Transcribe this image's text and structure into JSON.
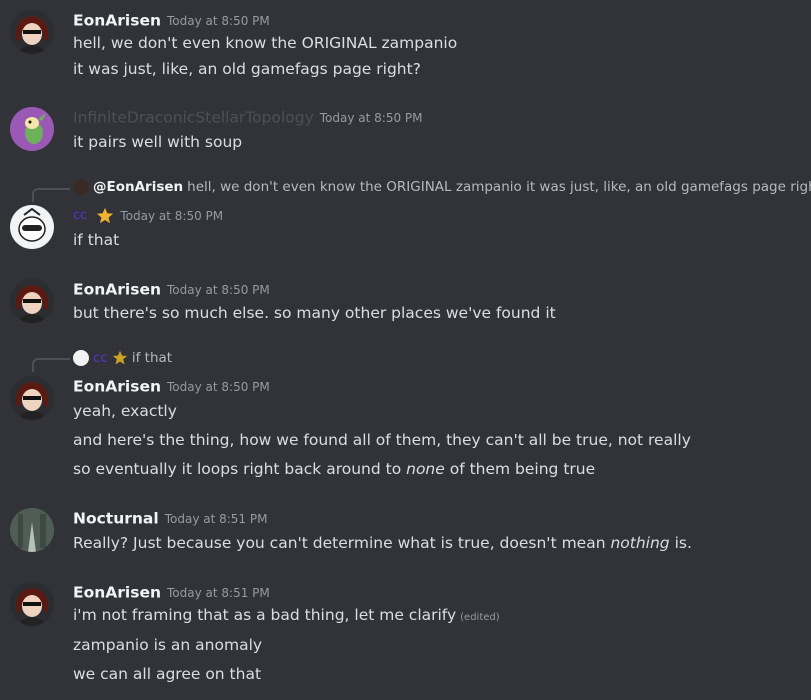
{
  "messages": [
    {
      "author": "EonArisen",
      "time": "Today at 8:50 PM",
      "lines": [
        "hell, we don't even know the ORIGINAL zampanio",
        "it was just, like, an old gamefags page right?"
      ]
    },
    {
      "author": "InfiniteDraconicStellarTopology",
      "time": "Today at 8:50 PM",
      "lines": [
        "it pairs well with soup"
      ]
    },
    {
      "reply": {
        "name": "@EonArisen",
        "text": "hell, we don't even know the ORIGINAL zampanio it was just, like, an old gamefags page right?"
      },
      "author": "cc",
      "time": "Today at 8:50 PM",
      "lines": [
        "if that"
      ]
    },
    {
      "author": "EonArisen",
      "time": "Today at 8:50 PM",
      "lines": [
        "but there's so much else. so many other places we've found it"
      ]
    },
    {
      "reply": {
        "name": "cc",
        "text": "if that"
      },
      "author": "EonArisen",
      "time": "Today at 8:50 PM",
      "lines": [
        "yeah, exactly",
        "and here's the thing, how we found all of them, they can't all be true, not really"
      ],
      "line3_pre": "so eventually it loops right back around to ",
      "line3_em": "none",
      "line3_post": " of them being true"
    },
    {
      "author": "Nocturnal",
      "time": "Today at 8:51 PM",
      "line_pre": "Really? Just because you can't determine what is true, doesn't mean ",
      "line_em": "nothing",
      "line_post": " is."
    },
    {
      "author": "EonArisen",
      "time": "Today at 8:51 PM",
      "lines": [
        "i'm not framing that as a bad thing, let me clarify",
        "zampanio is an anomaly",
        "we can all agree on that"
      ],
      "edited": "(edited)"
    }
  ],
  "colors": {
    "background": "#313338",
    "text": "#dbdee1",
    "timestamp": "#949ba4",
    "cc_name": "#5b2fd1"
  },
  "icons": {
    "star": "star-icon",
    "reply_spine": "reply-spine"
  }
}
